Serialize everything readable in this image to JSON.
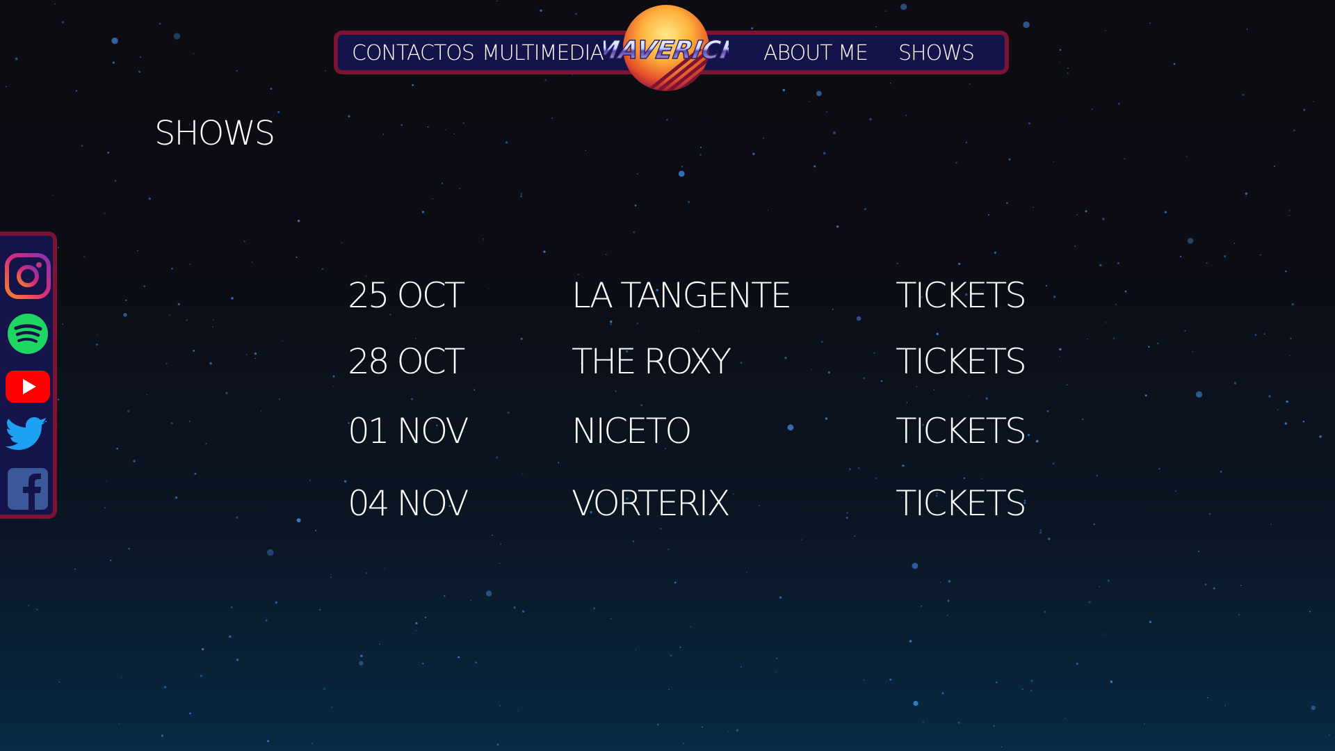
{
  "nav": {
    "left_items": [
      "CONTACTOS",
      "MULTIMEDIA"
    ],
    "right_items": [
      "ABOUT ME",
      "SHOWS"
    ],
    "logo_text": "MAVERICK"
  },
  "page": {
    "title": "SHOWS"
  },
  "shows": [
    {
      "date": "25 OCT",
      "venue": "LA TANGENTE",
      "tickets_label": "TICKETS"
    },
    {
      "date": "28 OCT",
      "venue": "THE ROXY",
      "tickets_label": "TICKETS"
    },
    {
      "date": "01 NOV",
      "venue": "NICETO",
      "tickets_label": "TICKETS"
    },
    {
      "date": "04 NOV",
      "venue": "VORTERIX",
      "tickets_label": "TICKETS"
    }
  ],
  "social": {
    "icons": [
      "instagram-icon",
      "spotify-icon",
      "youtube-icon",
      "twitter-icon",
      "facebook-icon"
    ]
  },
  "colors": {
    "nav_background": "#15144a",
    "nav_border": "#7a1432",
    "text": "#ffffff",
    "star": "#3f7fd0",
    "spotify": "#1ed760",
    "youtube": "#ff0000",
    "twitter": "#1da1f2",
    "facebook": "#3b5998"
  }
}
